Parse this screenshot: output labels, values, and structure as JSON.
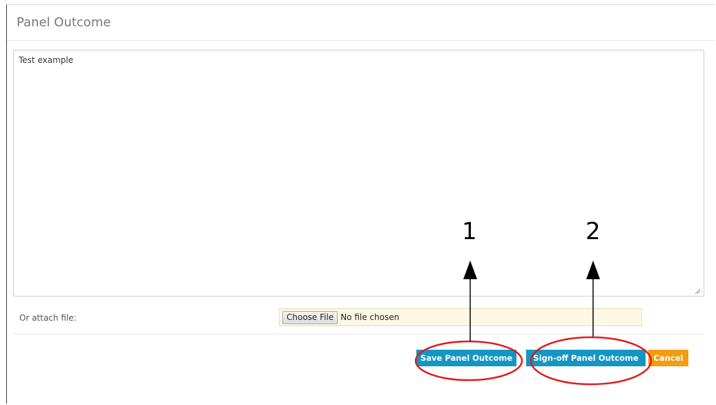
{
  "panel": {
    "title": "Panel Outcome"
  },
  "outcome": {
    "text": "Test example"
  },
  "attach": {
    "label": "Or attach file:",
    "button_label": "Choose File",
    "status": "No file chosen"
  },
  "actions": {
    "save_label": "Save Panel Outcome",
    "signoff_label": "Sign-off Panel Outcome",
    "cancel_label": "Cancel"
  },
  "annotations": {
    "callout_1": "1",
    "callout_2": "2"
  },
  "colors": {
    "primary_button": "#1496c3",
    "cancel_button": "#f39c12",
    "annotation_ring": "#e01b1b",
    "file_field_bg": "#fcf8e3"
  }
}
